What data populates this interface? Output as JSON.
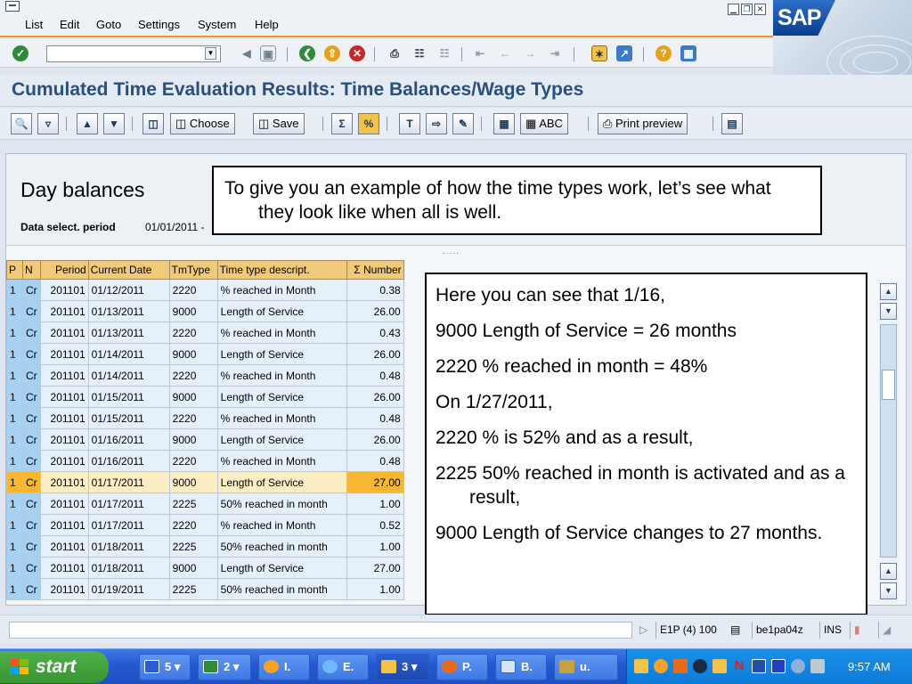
{
  "menu": {
    "items": [
      "List",
      "Edit",
      "Goto",
      "Settings",
      "System",
      "Help"
    ]
  },
  "window_controls": [
    "minimize",
    "restore",
    "close"
  ],
  "brand": {
    "logo_text": "SAP"
  },
  "toolbar": {
    "command_field_value": "",
    "icons": [
      "enter-icon",
      "back-icon",
      "save-icon",
      "green-back-icon",
      "exit-icon",
      "cancel-icon",
      "print-icon",
      "find-icon",
      "find-next-icon",
      "first-page-icon",
      "prev-page-icon",
      "next-page-icon",
      "last-page-icon",
      "create-session-icon",
      "shortcut-icon",
      "help-icon",
      "layout-icon"
    ]
  },
  "title": {
    "text": "Cumulated Time Evaluation Results: Time Balances/Wage Types"
  },
  "app_toolbar": {
    "choose_label": "Choose",
    "save_label": "Save",
    "abc_label": "ABC",
    "print_preview_label": "Print preview"
  },
  "panel": {
    "section_title": "Day balances",
    "selection_label": "Data select. period",
    "selection_value": "01/01/2011 -",
    "splitter": "....."
  },
  "table": {
    "columns": [
      "P",
      "N",
      "Period",
      "Current Date",
      "TmType",
      "Time type descript.",
      "Σ Number"
    ],
    "rows": [
      [
        "1",
        "Cr",
        "201101",
        "01/12/2011",
        "2220",
        "% reached in Month",
        "0.38"
      ],
      [
        "1",
        "Cr",
        "201101",
        "01/13/2011",
        "9000",
        "Length of Service",
        "26.00"
      ],
      [
        "1",
        "Cr",
        "201101",
        "01/13/2011",
        "2220",
        "% reached in Month",
        "0.43"
      ],
      [
        "1",
        "Cr",
        "201101",
        "01/14/2011",
        "9000",
        "Length of Service",
        "26.00"
      ],
      [
        "1",
        "Cr",
        "201101",
        "01/14/2011",
        "2220",
        "% reached in Month",
        "0.48"
      ],
      [
        "1",
        "Cr",
        "201101",
        "01/15/2011",
        "9000",
        "Length of Service",
        "26.00"
      ],
      [
        "1",
        "Cr",
        "201101",
        "01/15/2011",
        "2220",
        "% reached in Month",
        "0.48"
      ],
      [
        "1",
        "Cr",
        "201101",
        "01/16/2011",
        "9000",
        "Length of Service",
        "26.00"
      ],
      [
        "1",
        "Cr",
        "201101",
        "01/16/2011",
        "2220",
        "% reached in Month",
        "0.48"
      ],
      [
        "1",
        "Cr",
        "201101",
        "01/17/2011",
        "9000",
        "Length of Service",
        "27.00"
      ],
      [
        "1",
        "Cr",
        "201101",
        "01/17/2011",
        "2225",
        "50% reached in month",
        "1.00"
      ],
      [
        "1",
        "Cr",
        "201101",
        "01/17/2011",
        "2220",
        "% reached in Month",
        "0.52"
      ],
      [
        "1",
        "Cr",
        "201101",
        "01/18/2011",
        "2225",
        "50% reached in month",
        "1.00"
      ],
      [
        "1",
        "Cr",
        "201101",
        "01/18/2011",
        "9000",
        "Length of Service",
        "27.00"
      ],
      [
        "1",
        "Cr",
        "201101",
        "01/19/2011",
        "2225",
        "50% reached in month",
        "1.00"
      ]
    ],
    "highlighted_row_index": 9
  },
  "callouts": {
    "top": "To give you an example of how the time types work, let’s see what they look like when all is well.",
    "right": [
      "Here you can see that 1/16,",
      "9000 Length of Service = 26 months",
      "2220 % reached in month = 48%",
      "On 1/27/2011,",
      "2220 % is 52% and as a result,",
      "2225 50% reached in month is activated and as a result,",
      "9000 Length of Service changes to 27 months."
    ]
  },
  "status_bar": {
    "system": "E1P (4) 100",
    "server": "be1pa04z",
    "mode": "INS"
  },
  "taskbar": {
    "start_label": "start",
    "buttons": [
      {
        "label": "5",
        "icon": "word-icon"
      },
      {
        "label": "2",
        "icon": "excel-icon"
      },
      {
        "label": "I.",
        "icon": "clock-app-icon"
      },
      {
        "label": "E.",
        "icon": "ie-icon"
      },
      {
        "label": "3",
        "icon": "folder-icon"
      },
      {
        "label": "P.",
        "icon": "firefox-icon"
      },
      {
        "label": "B.",
        "icon": "sap-logon-icon"
      },
      {
        "label": "u.",
        "icon": "tool-icon"
      }
    ],
    "clock": "9:57 AM"
  },
  "colors": {
    "menu_accent": "#e79a2a",
    "title_text": "#2b4f7a",
    "header_cell": "#f0c97a",
    "key_cell": "#a8d0f0",
    "row_highlight": "#f7b733",
    "taskbar": "#2558d0",
    "start_green": "#3a9433"
  }
}
